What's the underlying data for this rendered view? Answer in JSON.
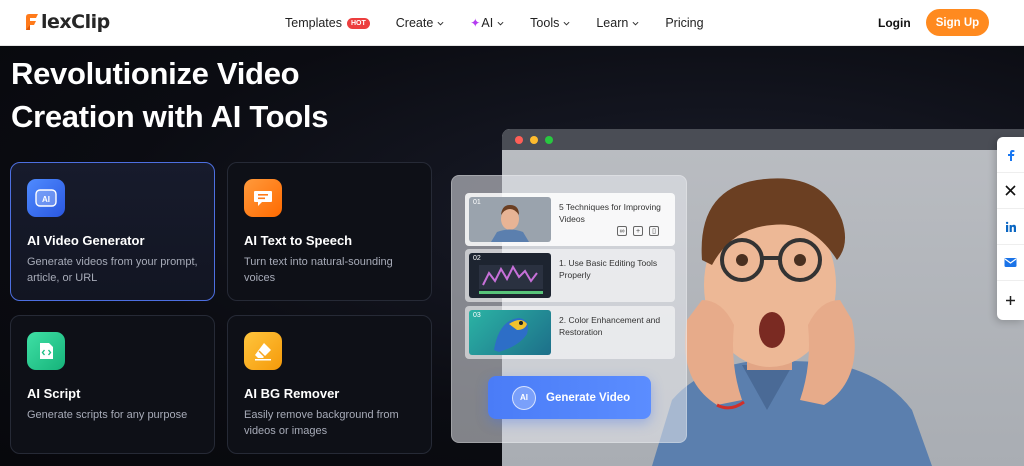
{
  "brand": {
    "logo_rest": "lexClip",
    "logo_initial": "F"
  },
  "nav": {
    "templates": "Templates",
    "hot_badge": "HOT",
    "create": "Create",
    "ai": "AI",
    "tools": "Tools",
    "learn": "Learn",
    "pricing": "Pricing",
    "login": "Login",
    "signup": "Sign Up"
  },
  "hero": {
    "title_line1": "Revolutionize Video",
    "title_line2": "Creation with AI Tools"
  },
  "cards": [
    {
      "title": "AI Video Generator",
      "desc": "Generate videos from your prompt, article, or URL",
      "icon": "ai-video-icon",
      "color": "#3b6cf3",
      "active": true
    },
    {
      "title": "AI Text to Speech",
      "desc": "Turn text into natural-sounding voices",
      "icon": "speech-bubble-icon",
      "color": "#ff7a1a"
    },
    {
      "title": "AI Script",
      "desc": "Generate scripts for any purpose",
      "icon": "script-icon",
      "color": "#22c98a"
    },
    {
      "title": "AI BG Remover",
      "desc": "Easily remove background from videos or images",
      "icon": "eraser-icon",
      "color": "#f5a623"
    }
  ],
  "showcase": {
    "items": [
      {
        "num": "01",
        "text": "5 Techniques for Improving Videos"
      },
      {
        "num": "02",
        "text": "1. Use Basic Editing Tools Properly"
      },
      {
        "num": "03",
        "text": "2. Color Enhancement and Restoration"
      }
    ],
    "generate_label": "Generate Video",
    "generate_icon_text": "AI"
  },
  "share": [
    "facebook-icon",
    "x-icon",
    "linkedin-icon",
    "email-icon",
    "plus-icon"
  ],
  "colors": {
    "accent": "#ff8a1f",
    "primary": "#4a7cf7",
    "hot": "#ec3e3e"
  }
}
